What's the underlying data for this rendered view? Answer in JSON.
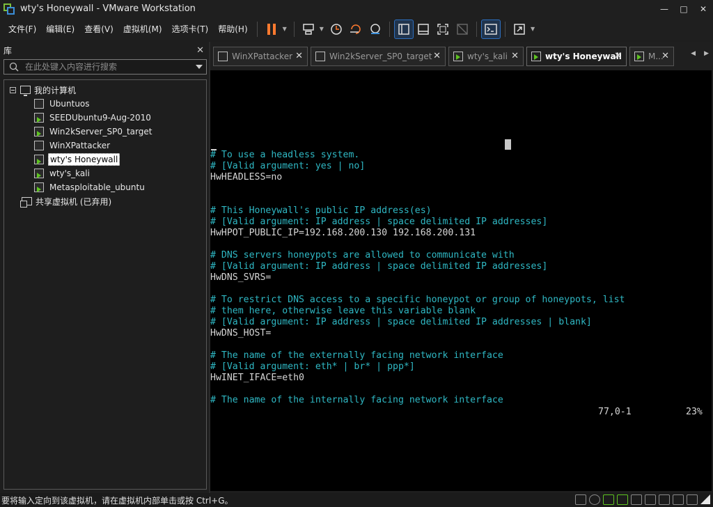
{
  "window": {
    "title": "wty's Honeywall - VMware Workstation",
    "minimize": "—",
    "maximize": "□",
    "close": "✕"
  },
  "menu": {
    "items": [
      "文件(F)",
      "编辑(E)",
      "查看(V)",
      "虚拟机(M)",
      "选项卡(T)",
      "帮助(H)"
    ]
  },
  "toolbar": {
    "icons": [
      "pause-icon",
      "send-keys-icon",
      "snapshot-icon",
      "revert-snapshot-icon",
      "snapshot-manager-icon",
      "library-view-icon",
      "thumbnail-icon",
      "fullscreen-icon",
      "unity-icon",
      "console-icon",
      "stretch-icon"
    ]
  },
  "library": {
    "title": "库",
    "close": "✕",
    "search_placeholder": "在此处键入内容进行搜索",
    "root": "我的计算机",
    "vms": [
      "Ubuntuos",
      "SEEDUbuntu9-Aug-2010",
      "Win2kServer_SP0_target",
      "WinXPattacker",
      "wty's Honeywall",
      "wty's_kali",
      "Metasploitable_ubuntu"
    ],
    "selected": "wty's Honeywall",
    "shared": "共享虚拟机 (已弃用)"
  },
  "tabs": [
    {
      "label": "WinXPattacker",
      "active": false
    },
    {
      "label": "Win2kServer_SP0_target",
      "active": false
    },
    {
      "label": "wty's_kali",
      "active": false
    },
    {
      "label": "wty's Honeywall",
      "active": true
    },
    {
      "label": "M...",
      "active": false
    }
  ],
  "tab_close": "✕",
  "tab_nav": {
    "prev": "◀",
    "next": "▶"
  },
  "console": {
    "lines": [
      {
        "text": "# To use a headless system.",
        "type": "comment",
        "row": 0
      },
      {
        "text": "# [Valid argument: yes | no]",
        "type": "comment",
        "row": 1
      },
      {
        "text": "HwHEADLESS=no",
        "type": "value",
        "row": 2
      },
      {
        "text": "# This Honeywall's public IP address(es)",
        "type": "comment",
        "row": 5
      },
      {
        "text": "# [Valid argument: IP address | space delimited IP addresses]",
        "type": "comment",
        "row": 6
      },
      {
        "text": "HwHPOT_PUBLIC_IP=192.168.200.130 192.168.200.131",
        "type": "value",
        "row": 7
      },
      {
        "text": "# DNS servers honeypots are allowed to communicate with",
        "type": "comment",
        "row": 9
      },
      {
        "text": "# [Valid argument: IP address | space delimited IP addresses]",
        "type": "comment",
        "row": 10
      },
      {
        "text": "HwDNS_SVRS=",
        "type": "value",
        "row": 11
      },
      {
        "text": "# To restrict DNS access to a specific honeypot or group of honeypots, list",
        "type": "comment",
        "row": 13
      },
      {
        "text": "# them here, otherwise leave this variable blank",
        "type": "comment",
        "row": 14
      },
      {
        "text": "# [Valid argument: IP address | space delimited IP addresses | blank]",
        "type": "comment",
        "row": 15
      },
      {
        "text": "HwDNS_HOST=",
        "type": "value",
        "row": 16
      },
      {
        "text": "# The name of the externally facing network interface",
        "type": "comment",
        "row": 18
      },
      {
        "text": "# [Valid argument: eth* | br* | ppp*]",
        "type": "comment",
        "row": 19
      },
      {
        "text": "HwINET_IFACE=eth0",
        "type": "value",
        "row": 20
      },
      {
        "text": "# The name of the internally facing network interface",
        "type": "comment",
        "row": 22
      }
    ],
    "position": "77,0-1",
    "percent": "23%"
  },
  "statusbar": {
    "text": "要将输入定向到该虚拟机，请在虚拟机内部单击或按 Ctrl+G。"
  }
}
